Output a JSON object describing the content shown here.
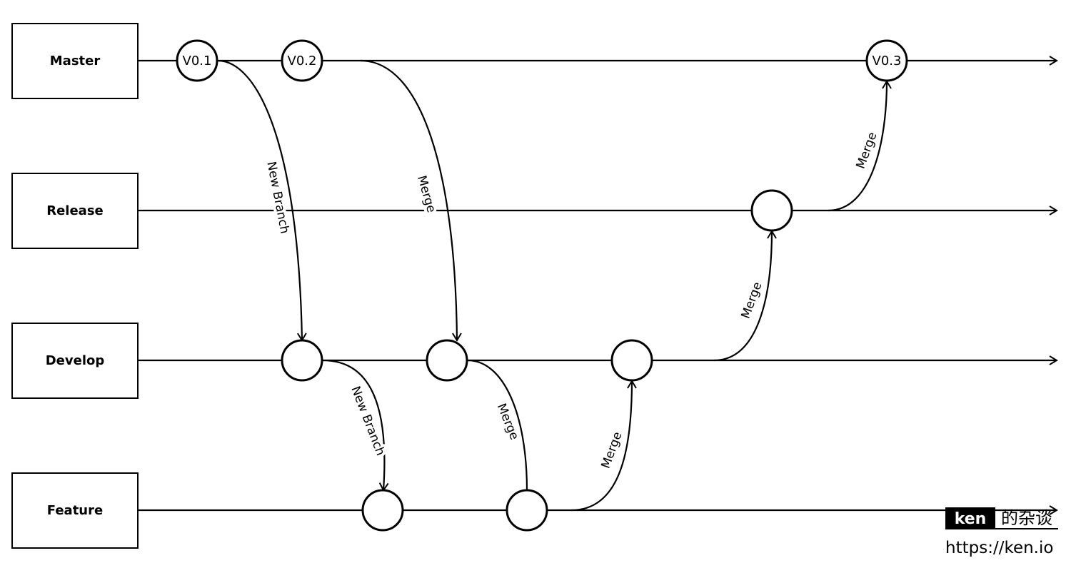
{
  "lanes": [
    {
      "label": "Master"
    },
    {
      "label": "Release"
    },
    {
      "label": "Develop"
    },
    {
      "label": "Feature"
    }
  ],
  "nodes": {
    "master": [
      "V0.1",
      "V0.2",
      "V0.3"
    ]
  },
  "edges": {
    "master_to_develop_new_branch": "New Branch",
    "master_to_develop_merge": "Merge",
    "develop_to_feature_new_branch": "New Branch",
    "develop_to_feature_merge": "Merge",
    "feature_to_develop_merge": "Merge",
    "develop_to_release_merge": "Merge",
    "release_to_master_merge": "Merge"
  },
  "watermark": {
    "brand": "ken",
    "subtitle": "的杂谈",
    "url": "https://ken.io"
  }
}
